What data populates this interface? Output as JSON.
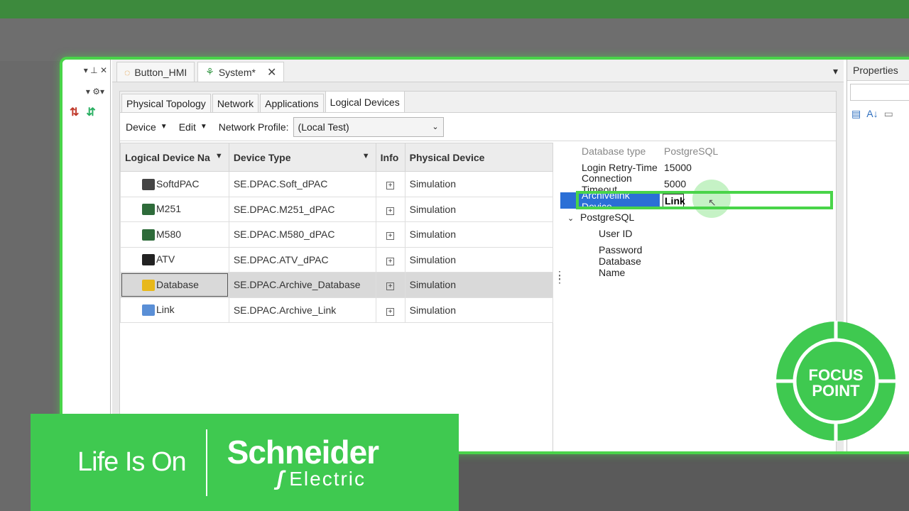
{
  "left_pane": {
    "pin_label": "▾ ⊥ ✕",
    "tool_label": "▾ ⚙▾"
  },
  "doc_tabs": [
    {
      "label": "Button_HMI",
      "active": false
    },
    {
      "label": "System*",
      "active": true
    }
  ],
  "doc_tab_close": "✕",
  "doc_menu": "▾",
  "sub_tabs": [
    "Physical Topology",
    "Network",
    "Applications",
    "Logical Devices"
  ],
  "toolbar": {
    "device_label": "Device",
    "edit_label": "Edit",
    "profile_label": "Network Profile:",
    "profile_value": "(Local Test)"
  },
  "grid": {
    "columns": [
      "Logical Device Na",
      "Device Type",
      "Info",
      "Physical Device"
    ],
    "rows": [
      {
        "name": "SoftdPAC",
        "type": "SE.DPAC.Soft_dPAC",
        "physical": "Simulation",
        "icon_color": "#444"
      },
      {
        "name": "M251",
        "type": "SE.DPAC.M251_dPAC",
        "physical": "Simulation",
        "icon_color": "#2e6b3a"
      },
      {
        "name": "M580",
        "type": "SE.DPAC.M580_dPAC",
        "physical": "Simulation",
        "icon_color": "#2e6b3a"
      },
      {
        "name": "ATV",
        "type": "SE.DPAC.ATV_dPAC",
        "physical": "Simulation",
        "icon_color": "#222"
      },
      {
        "name": "Database",
        "type": "SE.DPAC.Archive_Database",
        "physical": "Simulation",
        "icon_color": "#e8b81a"
      },
      {
        "name": "Link",
        "type": "SE.DPAC.Archive_Link",
        "physical": "Simulation",
        "icon_color": "#5a8fd6"
      }
    ],
    "selected_row": 4
  },
  "properties": {
    "rows": [
      {
        "name": "Database type",
        "value": "PostgreSQL",
        "muted": true
      },
      {
        "name": "Login Retry-Time",
        "value": "15000"
      },
      {
        "name": "Connection Timeout",
        "value": "5000"
      },
      {
        "name": "Archivelink Device",
        "value": "Link",
        "selected": true
      },
      {
        "name": "PostgreSQL",
        "value": "",
        "group": true
      },
      {
        "name": "User ID",
        "value": "",
        "child": true
      },
      {
        "name": "Password",
        "value": "",
        "child": true
      },
      {
        "name": "Database Name",
        "value": "",
        "child": true
      }
    ]
  },
  "right_pane": {
    "title": "Properties"
  },
  "brand": {
    "tagline": "Life Is On",
    "company": "Schneider",
    "company_sub": "Electric"
  },
  "badge": {
    "line1": "FOCUS",
    "line2": "POINT"
  },
  "colors": {
    "accent_green": "#49d449",
    "brand_green": "#3fc950",
    "selection_blue": "#2b6fd6"
  }
}
